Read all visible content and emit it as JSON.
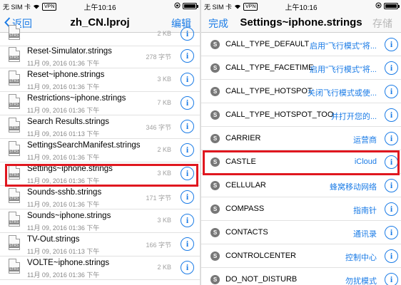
{
  "left": {
    "status": {
      "carrier": "无 SIM 卡",
      "vpn": "VPN",
      "time": "上午10:16",
      "battery_icon": "battery-icon",
      "lock_icon": "lock-rotation-icon",
      "battery_level": 1.0
    },
    "nav": {
      "back_label": "返回",
      "title": "zh_CN.lproj",
      "edit_label": "编辑"
    },
    "files": [
      {
        "name": "",
        "date": "",
        "size": "2 KB"
      },
      {
        "name": "Reset-Simulator.strings",
        "date": "11月 09, 2016 01:36 下午",
        "size": "278 字节"
      },
      {
        "name": "Reset~iphone.strings",
        "date": "11月 09, 2016 01:36 下午",
        "size": "3 KB"
      },
      {
        "name": "Restrictions~iphone.strings",
        "date": "11月 09, 2016 01:36 下午",
        "size": "7 KB"
      },
      {
        "name": "Search Results.strings",
        "date": "11月 09, 2016 01:13 下午",
        "size": "346 字节"
      },
      {
        "name": "SettingsSearchManifest.strings",
        "date": "11月 09, 2016 01:36 下午",
        "size": "2 KB"
      },
      {
        "name": "Settings~iphone.strings",
        "date": "11月 09, 2016 01:36 下午",
        "size": "3 KB"
      },
      {
        "name": "Sounds-sshb.strings",
        "date": "11月 09, 2016 01:36 下午",
        "size": "171 字节"
      },
      {
        "name": "Sounds~iphone.strings",
        "date": "11月 09, 2016 01:36 下午",
        "size": "3 KB"
      },
      {
        "name": "TV-Out.strings",
        "date": "11月 09, 2016 01:13 下午",
        "size": "166 字节"
      },
      {
        "name": "VOLTE~iphone.strings",
        "date": "11月 09, 2016 01:36 下午",
        "size": "2 KB"
      }
    ],
    "file_badge": "STRS"
  },
  "right": {
    "status": {
      "carrier": "无 SIM 卡",
      "vpn": "VPN",
      "time": "上午10:16",
      "battery_level": 1.0
    },
    "nav": {
      "done_label": "完成",
      "title": "Settings~iphone.strings",
      "save_label": "存储"
    },
    "badge": "S",
    "keys": [
      {
        "key": "CALL_TYPE_DEFAULT",
        "value": "启用\"飞行模式\"将..."
      },
      {
        "key": "CALL_TYPE_FACETIME",
        "value": "启用\"飞行模式\"将..."
      },
      {
        "key": "CALL_TYPE_HOTSPOT",
        "value": "关闭飞行模式或使..."
      },
      {
        "key": "CALL_TYPE_HOTSPOT_TOO",
        "value": "并打开您的..."
      },
      {
        "key": "CARRIER",
        "value": "运营商"
      },
      {
        "key": "CASTLE",
        "value": "iCloud"
      },
      {
        "key": "CELLULAR",
        "value": "蜂窝移动网络"
      },
      {
        "key": "COMPASS",
        "value": "指南针"
      },
      {
        "key": "CONTACTS",
        "value": "通讯录"
      },
      {
        "key": "CONTROLCENTER",
        "value": "控制中心"
      },
      {
        "key": "DO_NOT_DISTURB",
        "value": "勿扰模式"
      }
    ]
  },
  "info_glyph": "i",
  "colors": {
    "accent": "#1a7be6",
    "highlight": "#e0171f"
  }
}
